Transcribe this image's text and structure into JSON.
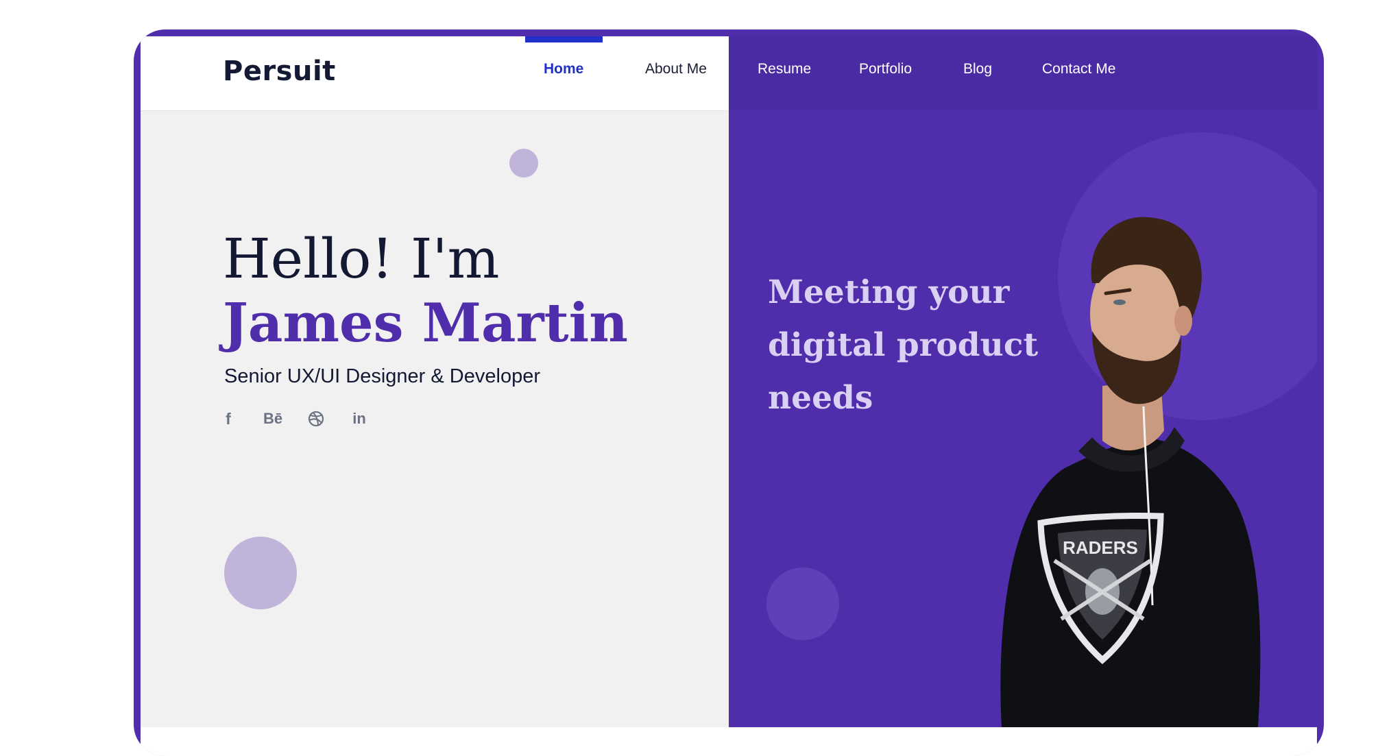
{
  "colors": {
    "brand_purple": "#4f2dab",
    "nav_purple": "#4a2ba3",
    "active_blue": "#2030c8",
    "dark_text": "#131833",
    "light_circle": "#c0b4db",
    "tagline": "#d9d0f3",
    "page_bg": "#f1f1f1"
  },
  "brand": {
    "logo": "Persuit"
  },
  "nav": {
    "items": [
      {
        "label": "Home",
        "active": true
      },
      {
        "label": "About Me"
      },
      {
        "label": "Resume"
      },
      {
        "label": "Portfolio"
      },
      {
        "label": "Blog"
      },
      {
        "label": "Contact Me"
      }
    ]
  },
  "hero": {
    "greeting": "Hello! I'm",
    "name": "James Martin",
    "role": "Senior UX/UI Designer & Developer",
    "socials": [
      {
        "icon": "facebook-icon",
        "glyph": "f"
      },
      {
        "icon": "behance-icon",
        "glyph": "Bē"
      },
      {
        "icon": "dribbble-icon"
      },
      {
        "icon": "linkedin-icon",
        "glyph": "in"
      }
    ]
  },
  "tagline": {
    "lines": [
      "Meeting your",
      "digital product",
      "needs"
    ]
  },
  "portrait": {
    "alt": "man-in-raiders-sweatshirt-photo",
    "shirt_text": "RADERS"
  }
}
